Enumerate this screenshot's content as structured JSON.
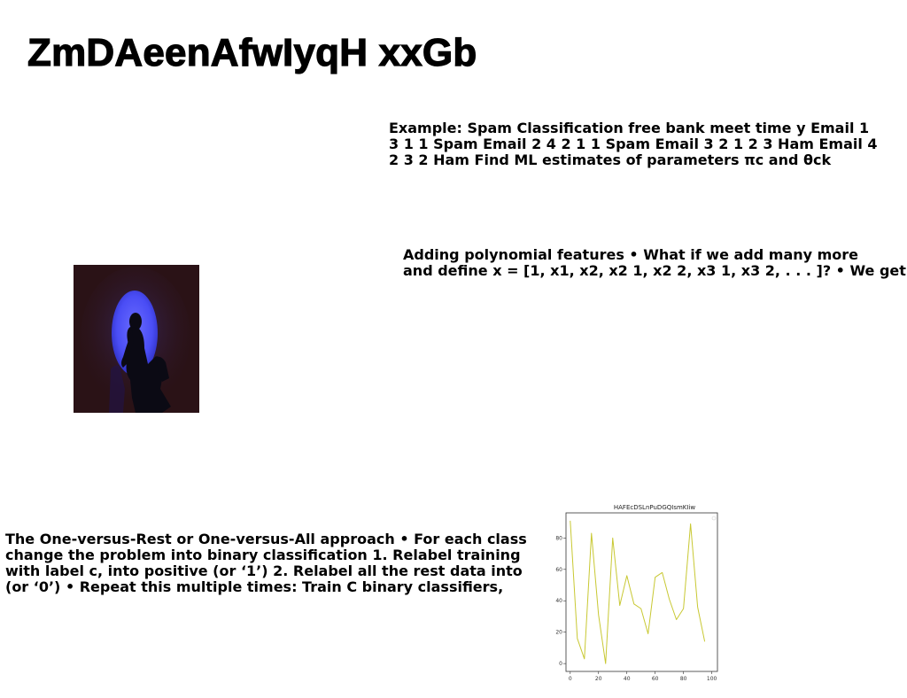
{
  "page": {
    "title": "ZmDAeenAfwIyqH xxGb"
  },
  "blocks": {
    "spam": "Example: Spam Classification free bank meet time y Email 1\n3 1 1 Spam Email 2 4 2 1 1 Spam Email 3 2 1 2 3 Ham Email 4\n2 3 2 Ham Find ML estimates of parameters πc and θck",
    "poly": "Adding polynomial features • What if we add many more\nand define x = [1, x1, x2, x2 1, x2 2, x3 1, x3 2, . . . ]? • We get",
    "ovr": "The One-versus-Rest or One-versus-All approach • For each class\nchange the problem into binary classification 1. Relabel training\nwith label c, into positive (or ‘1’) 2. Relabel all the rest data into\n(or ‘0’) • Repeat this multiple times: Train C binary classifiers,"
  },
  "photo": {
    "icon": "person-silhouette-blue-spotlight-photo",
    "colors": {
      "background": "#2a1216",
      "spotlight": "#4a4df5",
      "figure": "#0b0a14"
    }
  },
  "chart_data": {
    "type": "line",
    "title": "HAFEcDSLnPuDGQIsmKIiw",
    "x": [
      0,
      5,
      10,
      15,
      20,
      25,
      30,
      35,
      40,
      45,
      50,
      55,
      60,
      65,
      70,
      75,
      80,
      85,
      90,
      95,
      100
    ],
    "series": [
      {
        "values": [
          91,
          16,
          3,
          83,
          31,
          0,
          80,
          37,
          56,
          38,
          35,
          19,
          55,
          58,
          41,
          28,
          35,
          89,
          36,
          14
        ]
      }
    ],
    "series_color": "#c8c832",
    "xlim": [
      -3,
      104
    ],
    "ylim": [
      -5,
      96
    ],
    "xticks": [
      0,
      20,
      40,
      60,
      80,
      100
    ],
    "yticks": [
      0,
      20,
      40,
      60,
      80
    ],
    "grid": false,
    "legend": "top-right"
  }
}
